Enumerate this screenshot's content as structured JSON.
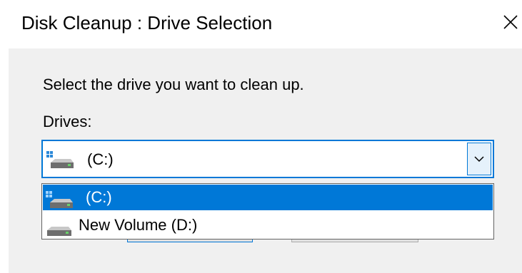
{
  "window": {
    "title": "Disk Cleanup : Drive Selection"
  },
  "dialog": {
    "prompt": "Select the drive you want to clean up.",
    "drives_label": "Drives:",
    "selected_value": "(C:)"
  },
  "dropdown": {
    "items": [
      {
        "label": "(C:)",
        "icon": "system-drive-icon",
        "selected": true
      },
      {
        "label": "New Volume (D:)",
        "icon": "drive-icon",
        "selected": false
      }
    ]
  },
  "colors": {
    "accent": "#0078d7",
    "selection_text": "#ffffff",
    "dialog_background": "#f0f0f0"
  }
}
